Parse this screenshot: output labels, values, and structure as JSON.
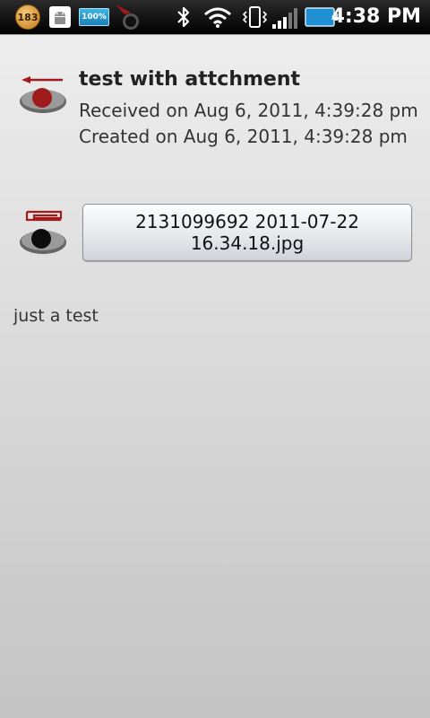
{
  "status_bar": {
    "notification_badge": "183",
    "battery_small_label": "100%",
    "time": "4:38 PM",
    "icons": [
      "badge-icon",
      "android-icon",
      "battery-widget-icon",
      "radar-icon",
      "bluetooth-icon",
      "wifi-icon",
      "vibrate-icon",
      "signal-icon",
      "battery-icon"
    ]
  },
  "message": {
    "title": "test with attchment",
    "received": "Received on Aug 6, 2011, 4:39:28 pm",
    "created": "Created on Aug 6, 2011, 4:39:28 pm",
    "icon": "received-message-icon"
  },
  "attachment": {
    "line1": "2131099692 2011-07-22",
    "line2": "16.34.18.jpg",
    "icon": "attachment-icon"
  },
  "body": {
    "text": "just a test"
  },
  "colors": {
    "accent_red": "#9b1c1c",
    "status_bar": "#000000"
  }
}
